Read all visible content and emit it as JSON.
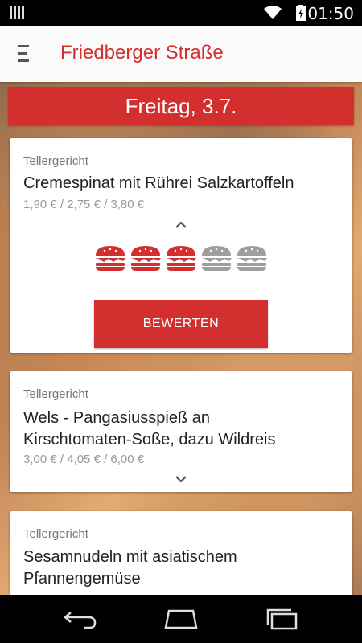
{
  "status_bar": {
    "time": "01:50"
  },
  "toolbar": {
    "title": "Friedberger Straße"
  },
  "day": {
    "label": "Freitag, 3.7."
  },
  "meals": [
    {
      "category": "Tellergericht",
      "name": "Cremespinat mit Rührei Salzkartoffeln",
      "price": "1,90 € / 2,75 € / 3,80 €",
      "expanded": true,
      "rating": 3,
      "rating_max": 5,
      "rate_button": "BEWERTEN"
    },
    {
      "category": "Tellergericht",
      "name_lines": [
        "Wels - Pangasiusspieß an",
        "Kirschtomaten-Soße, dazu Wildreis"
      ],
      "price": "3,00 € / 4,05 € / 6,00 €",
      "expanded": false
    },
    {
      "category": "Tellergericht",
      "name_lines": [
        "Sesamnudeln mit asiatischem",
        "Pfannengemüse"
      ]
    }
  ],
  "icons": {
    "menu": "menu-icon",
    "collapse": "chevron-up-icon",
    "expand": "chevron-down-icon",
    "back": "back-icon",
    "home": "home-icon",
    "recents": "recents-icon"
  },
  "colors": {
    "accent": "#d32f2f",
    "rating_active": "#d32f2f",
    "rating_inactive": "#9e9e9e"
  }
}
